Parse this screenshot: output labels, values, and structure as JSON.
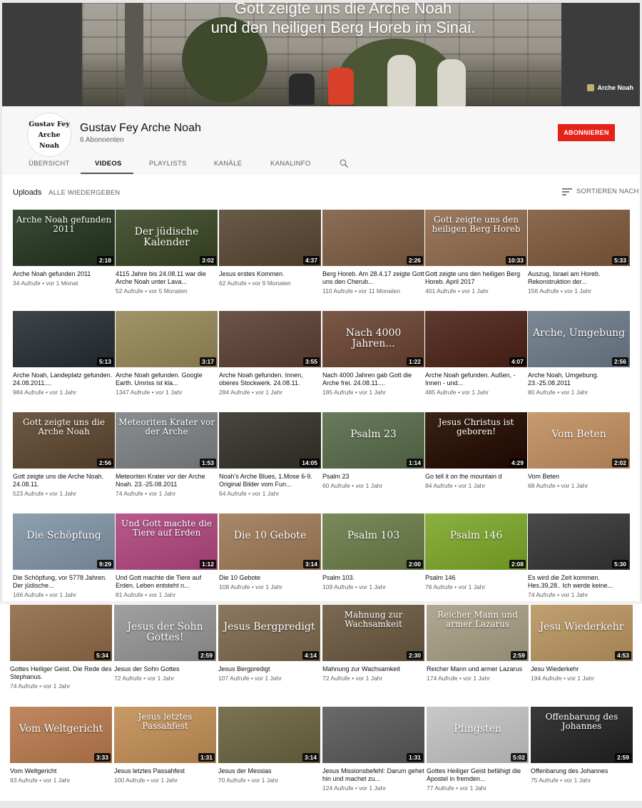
{
  "banner": {
    "line1": "Gott zeigte uns die Arche Noah",
    "line2": "und den heiligen Berg Horeb im Sinai.",
    "link_label": "Arche Noah"
  },
  "channel": {
    "avatar_lines": [
      "Gustav Fey",
      "Arche",
      "Noah"
    ],
    "name": "Gustav Fey Arche Noah",
    "subscribers": "6 Abonnenten",
    "subscribe_label": "ABONNIEREN"
  },
  "tabs": [
    "ÜBERSICHT",
    "VIDEOS",
    "PLAYLISTS",
    "KANÄLE",
    "KANALINFO"
  ],
  "uploads": {
    "label": "Uploads",
    "play_all": "ALLE WIEDERGEBEN",
    "sort": "SORTIEREN NACH"
  },
  "videos": [
    {
      "title": "Arche Noah gefunden 2011",
      "meta": "34 Aufrufe • vor 1 Monat",
      "duration": "2:18",
      "thumb_text": "Arche Noah gefunden 2011",
      "bg": "#3a4a36"
    },
    {
      "title": "4115 Jahre bis 24.08.11 war die Arche Noah unter Lava...",
      "meta": "52 Aufrufe • vor 5 Monaten",
      "duration": "3:02",
      "thumb_text": "Der jüdische Kalender",
      "bg": "#4f5a3c"
    },
    {
      "title": "Jesus erstes Kommen.",
      "meta": "62 Aufrufe • vor 9 Monaten",
      "duration": "4:37",
      "thumb_text": "",
      "bg": "#6a5a48"
    },
    {
      "title": "Berg Horeb. Am 28.4.17 zeigte Gott uns den Cherub...",
      "meta": "110 Aufrufe • vor 11 Monaten",
      "duration": "2:26",
      "thumb_text": "",
      "bg": "#8a6e58"
    },
    {
      "title": "Gott zeigte uns den heiligen Berg Horeb. April 2017",
      "meta": "401 Aufrufe • vor 1 Jahr",
      "duration": "10:33",
      "thumb_text": "Gott zeigte uns den heiligen Berg Horeb",
      "bg": "#9c7a60"
    },
    {
      "title": "Auszug, Israel am Horeb. Rekonstruktion der...",
      "meta": "156 Aufrufe • vor 1 Jahr",
      "duration": "5:33",
      "thumb_text": "",
      "bg": "#8c6a50"
    },
    {
      "title": "Arche Noah, Landeplatz gefunden. 24.08.2011....",
      "meta": "984 Aufrufe • vor 1 Jahr",
      "duration": "5:13",
      "thumb_text": "",
      "bg": "#3e4448"
    },
    {
      "title": "Arche Noah gefunden. Google Earth. Umriss ist kla...",
      "meta": "1347 Aufrufe • vor 1 Jahr",
      "duration": "3:17",
      "thumb_text": "",
      "bg": "#a09468"
    },
    {
      "title": "Arche Noah gefunden. Innen, oberes Stockwerk. 24.08.11.",
      "meta": "284 Aufrufe • vor 1 Jahr",
      "duration": "3:55",
      "thumb_text": "",
      "bg": "#6c5448"
    },
    {
      "title": "Nach 4000 Jahren gab Gott die Arche frei. 24.08.11....",
      "meta": "185 Aufrufe • vor 1 Jahr",
      "duration": "1:22",
      "thumb_text": "Nach 4000 Jahren...",
      "bg": "#7a5848"
    },
    {
      "title": "Arche Noah gefunden. Außen, - Innen - und...",
      "meta": "485 Aufrufe • vor 1 Jahr",
      "duration": "4:07",
      "thumb_text": "",
      "bg": "#5e3a30"
    },
    {
      "title": "Arche Noah, Umgebung. 23.-25.08.2011",
      "meta": "80 Aufrufe • vor 1 Jahr",
      "duration": "2:56",
      "thumb_text": "Arche, Umgebung",
      "bg": "#7c8894"
    },
    {
      "title": "Gott zeigte uns die Arche Noah. 24.08.11.",
      "meta": "523 Aufrufe • vor 1 Jahr",
      "duration": "2:56",
      "thumb_text": "Gott zeigte uns die Arche Noah",
      "bg": "#6e5a44"
    },
    {
      "title": "Meteoriten Krater vor der Arche Noah. 23.-25.08.2011",
      "meta": "74 Aufrufe • vor 1 Jahr",
      "duration": "1:53",
      "thumb_text": "Meteoriten Krater vor der Arche",
      "bg": "#8a8e90"
    },
    {
      "title": "Noah's Arche Blues, 1.Mose 6-9. Original Bilder vom Fun...",
      "meta": "64 Aufrufe • vor 1 Jahr",
      "duration": "14:05",
      "thumb_text": "",
      "bg": "#4a4640"
    },
    {
      "title": "Psalm 23",
      "meta": "60 Aufrufe • vor 1 Jahr",
      "duration": "1:14",
      "thumb_text": "Psalm 23",
      "bg": "#6a7a5c"
    },
    {
      "title": "Go tell it on the mountain d",
      "meta": "84 Aufrufe • vor 1 Jahr",
      "duration": "4:29",
      "thumb_text": "Jesus Christus ist geboren!",
      "bg": "#3a2414"
    },
    {
      "title": "Vom Beten",
      "meta": "68 Aufrufe • vor 1 Jahr",
      "duration": "2:02",
      "thumb_text": "Vom Beten",
      "bg": "#c89a70"
    },
    {
      "title": "Die Schöpfung, vor 5778 Jahren. Der jüdische...",
      "meta": "166 Aufrufe • vor 1 Jahr",
      "duration": "9:29",
      "thumb_text": "Die Schöpfung",
      "bg": "#8ea0b0"
    },
    {
      "title": "Und Gott machte die Tiere auf Erden. Leben entsteht n...",
      "meta": "81 Aufrufe • vor 1 Jahr",
      "duration": "1:12",
      "thumb_text": "Und Gott machte die Tiere auf Erden",
      "bg": "#b85a8c"
    },
    {
      "title": "Die 10 Gebote",
      "meta": "108 Aufrufe • vor 1 Jahr",
      "duration": "3:14",
      "thumb_text": "Die 10 Gebote",
      "bg": "#a88868"
    },
    {
      "title": "Psalm 103.",
      "meta": "109 Aufrufe • vor 1 Jahr",
      "duration": "2:00",
      "thumb_text": "Psalm 103",
      "bg": "#7a8a5a"
    },
    {
      "title": "Psalm 146",
      "meta": "76 Aufrufe • vor 1 Jahr",
      "duration": "2:08",
      "thumb_text": "Psalm 146",
      "bg": "#8ab040"
    },
    {
      "title": "Es wird die Zeit kommen. Hes.39,28.. Ich werde keine...",
      "meta": "74 Aufrufe • vor 1 Jahr",
      "duration": "5:30",
      "thumb_text": "",
      "bg": "#4a4a4a"
    },
    {
      "title": "Gottes Heiliger Geist. Die Rede des Stephanus.",
      "meta": "74 Aufrufe • vor 1 Jahr",
      "duration": "5:34",
      "thumb_text": "",
      "bg": "#9a7a5a"
    },
    {
      "title": "Jesus der Sohn Gottes",
      "meta": "72 Aufrufe • vor 1 Jahr",
      "duration": "2:59",
      "thumb_text": "Jesus der Sohn Gottes!",
      "bg": "#a0a0a0"
    },
    {
      "title": "Jesus Bergpredigt",
      "meta": "107 Aufrufe • vor 1 Jahr",
      "duration": "4:14",
      "thumb_text": "Jesus Bergpredigt",
      "bg": "#8a7860"
    },
    {
      "title": "Mahnung zur Wachsamkeit",
      "meta": "72 Aufrufe • vor 1 Jahr",
      "duration": "2:30",
      "thumb_text": "Mahnung zur Wachsamkeit",
      "bg": "#7a6a54"
    },
    {
      "title": "Reicher Mann und armer Lazarus",
      "meta": "174 Aufrufe • vor 1 Jahr",
      "duration": "2:59",
      "thumb_text": "Reicher Mann und armer Lazarus",
      "bg": "#b0a890"
    },
    {
      "title": "Jesu Wiederkehr",
      "meta": "194 Aufrufe • vor 1 Jahr",
      "duration": "4:53",
      "thumb_text": "Jesu Wiederkehr",
      "bg": "#c0a070"
    },
    {
      "title": "Vom Weltgericht",
      "meta": "93 Aufrufe • vor 1 Jahr",
      "duration": "3:33",
      "thumb_text": "Vom Weltgericht",
      "bg": "#c08860"
    },
    {
      "title": "Jesus letztes Passahfest",
      "meta": "100 Aufrufe • vor 1 Jahr",
      "duration": "1:31",
      "thumb_text": "Jesus letztes Passahfest",
      "bg": "#c89a68"
    },
    {
      "title": "Jesus der Messias",
      "meta": "70 Aufrufe • vor 1 Jahr",
      "duration": "3:14",
      "thumb_text": "",
      "bg": "#7a7454"
    },
    {
      "title": "Jesus Missionsbefehl: Darum gehet hin und machet zu...",
      "meta": "124 Aufrufe • vor 1 Jahr",
      "duration": "1:31",
      "thumb_text": "",
      "bg": "#6a6a6a"
    },
    {
      "title": "Gottes Heiliger Geist befähigt die Apostel in fremden...",
      "meta": "77 Aufrufe • vor 1 Jahr",
      "duration": "5:02",
      "thumb_text": "Pfingsten",
      "bg": "#c8c8c8"
    },
    {
      "title": "Offenbarung des Johannes",
      "meta": "75 Aufrufe • vor 1 Jahr",
      "duration": "2:59",
      "thumb_text": "Offenbarung des Johannes",
      "bg": "#3a3a3a"
    }
  ]
}
